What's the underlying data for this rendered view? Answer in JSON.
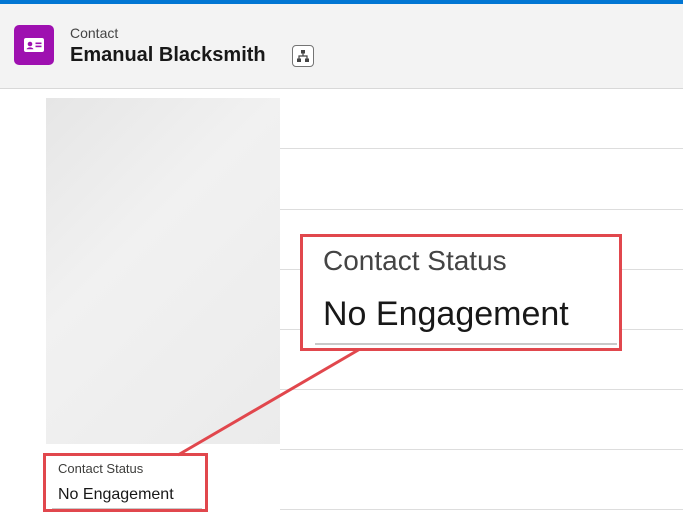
{
  "header": {
    "object_label": "Contact",
    "record_name": "Emanual Blacksmith",
    "record_icon": "contact-card-icon",
    "hierarchy_icon": "hierarchy-icon"
  },
  "field": {
    "label": "Contact Status",
    "value": "No Engagement"
  },
  "zoom_callout": {
    "label": "Contact Status",
    "value": "No Engagement"
  },
  "colors": {
    "accent_bar": "#0176d3",
    "record_icon_bg": "#9e10b0",
    "highlight": "#e1474d"
  }
}
